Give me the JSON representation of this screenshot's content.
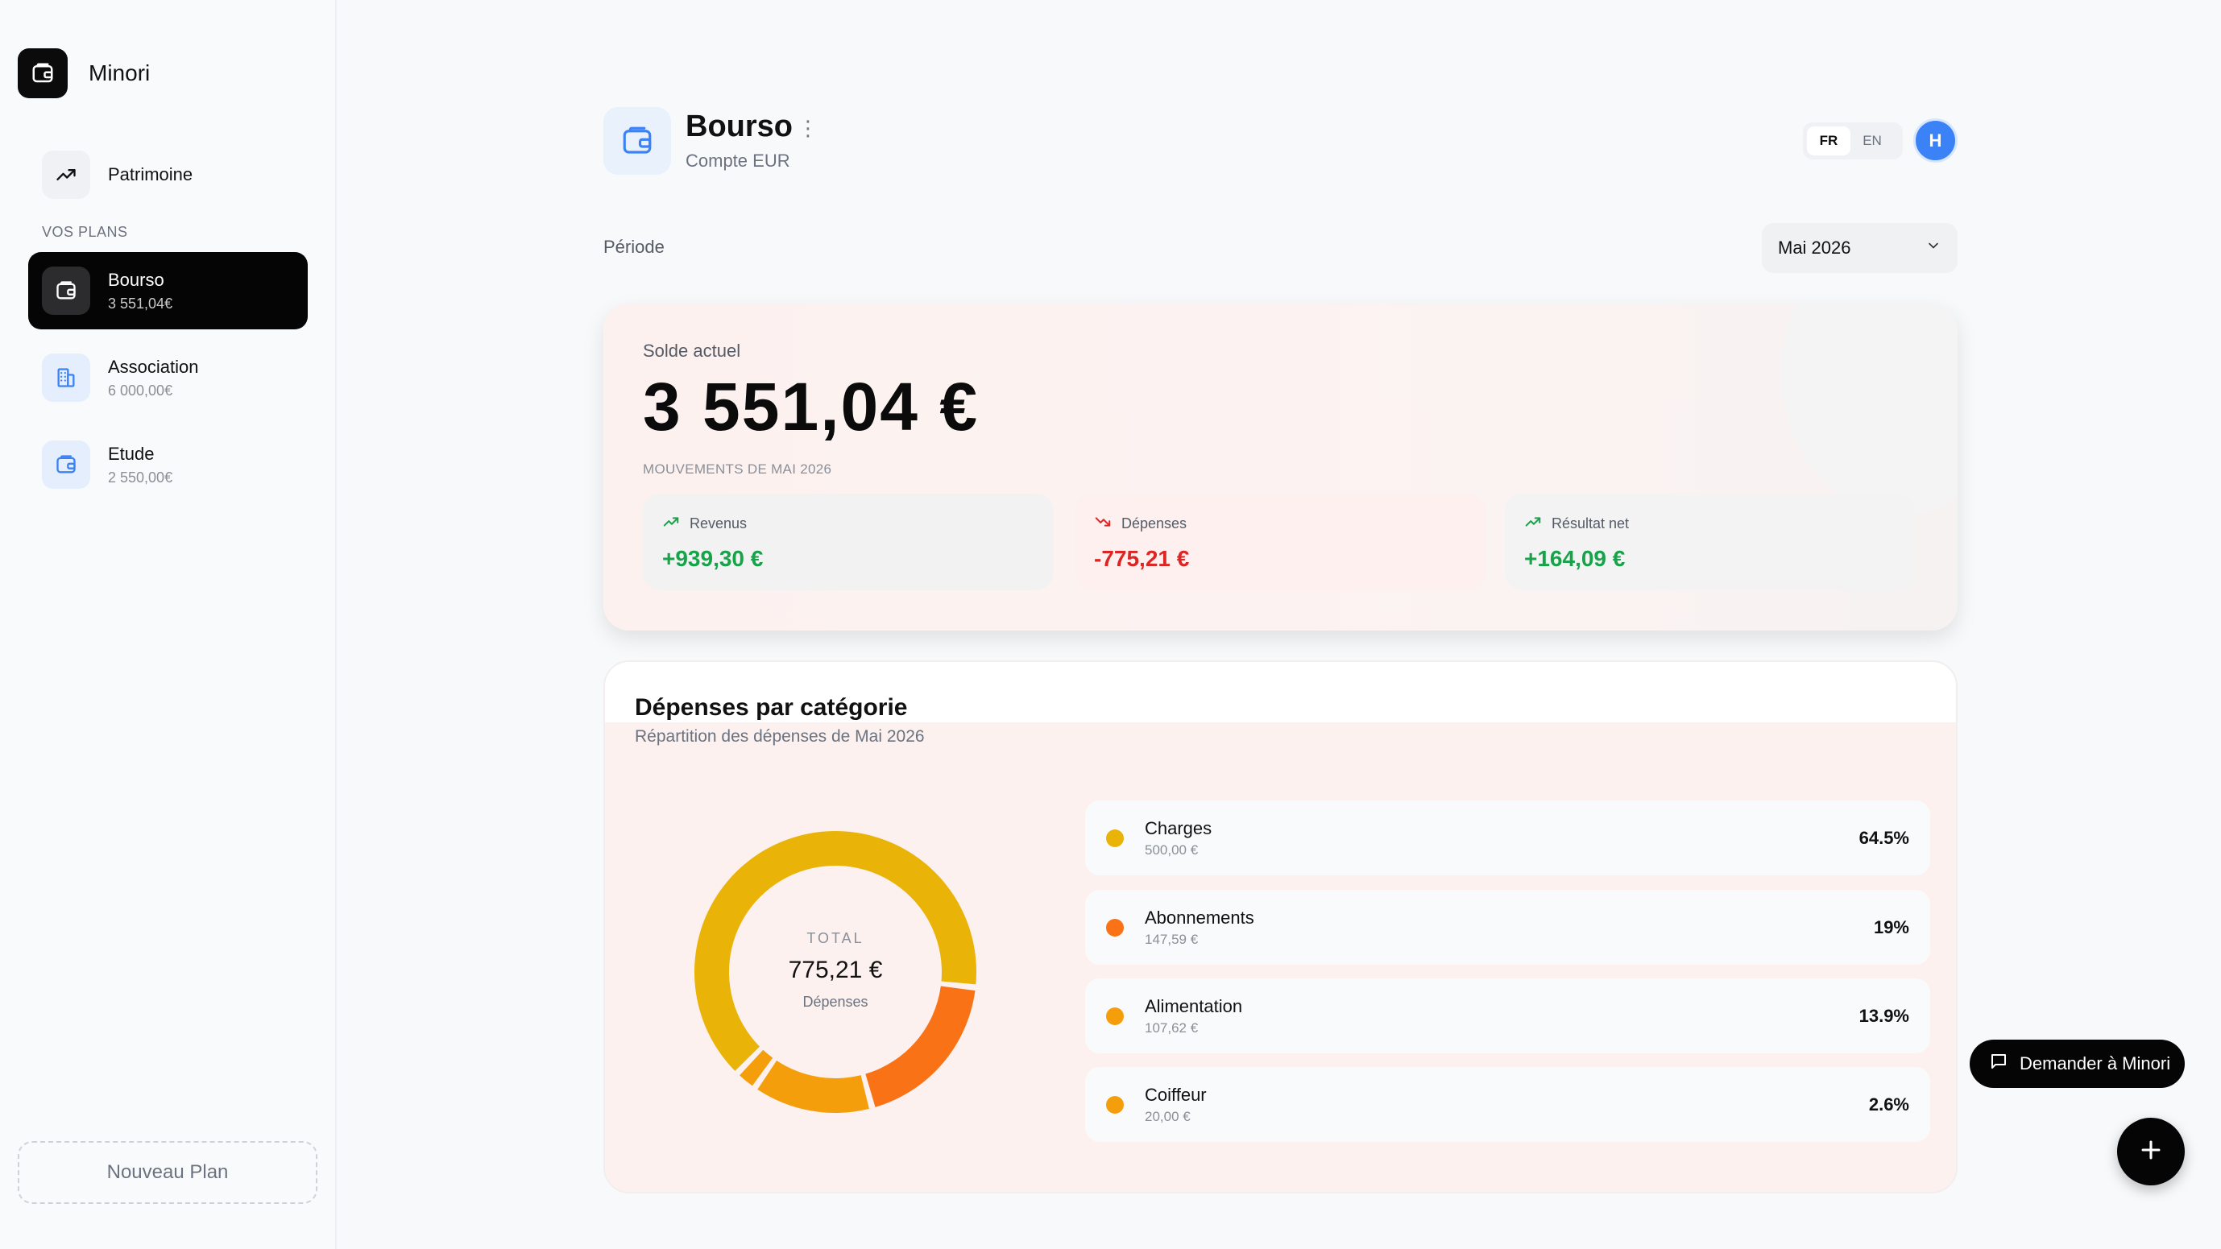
{
  "app": {
    "name": "Minori"
  },
  "sidebar": {
    "patrimoine_label": "Patrimoine",
    "section_title": "VOS PLANS",
    "plans": [
      {
        "name": "Bourso",
        "amount": "3 551,04€",
        "icon": "wallet-icon",
        "active": true
      },
      {
        "name": "Association",
        "amount": "6 000,00€",
        "icon": "building-icon",
        "active": false
      },
      {
        "name": "Etude",
        "amount": "2 550,00€",
        "icon": "wallet-icon",
        "active": false
      }
    ],
    "new_plan_label": "Nouveau Plan"
  },
  "header": {
    "title": "Bourso",
    "subtitle": "Compte EUR",
    "menu_icon": "⋮",
    "languages": [
      "FR",
      "EN"
    ],
    "active_language": "FR",
    "avatar_initial": "H"
  },
  "period": {
    "label": "Période",
    "selected": "Mai 2026"
  },
  "balance": {
    "label": "Solde actuel",
    "amount": "3 551,04 €",
    "movements_label": "MOUVEMENTS DE MAI 2026",
    "stats": {
      "revenus": {
        "label": "Revenus",
        "value": "+939,30 €"
      },
      "depenses": {
        "label": "Dépenses",
        "value": "-775,21 €"
      },
      "net": {
        "label": "Résultat net",
        "value": "+164,09 €"
      }
    }
  },
  "categories": {
    "title": "Dépenses par catégorie",
    "subtitle": "Répartition des dépenses de Mai 2026",
    "total_label": "TOTAL",
    "total_value": "775,21 €",
    "total_sub": "Dépenses",
    "items": [
      {
        "name": "Charges",
        "amount": "500,00 €",
        "pct": "64.5%",
        "color": "#eab308"
      },
      {
        "name": "Abonnements",
        "amount": "147,59 €",
        "pct": "19%",
        "color": "#f97316"
      },
      {
        "name": "Alimentation",
        "amount": "107,62 €",
        "pct": "13.9%",
        "color": "#f59e0b"
      },
      {
        "name": "Coiffeur",
        "amount": "20,00 €",
        "pct": "2.6%",
        "color": "#f59e0b"
      }
    ]
  },
  "chart_data": {
    "type": "pie",
    "categories": [
      "Charges",
      "Abonnements",
      "Alimentation",
      "Coiffeur"
    ],
    "values": [
      500.0,
      147.59,
      107.62,
      20.0
    ],
    "colors": [
      "#eab308",
      "#f97316",
      "#f59e0b",
      "#f59e0b"
    ]
  },
  "assistant": {
    "label": "Demander à Minori"
  },
  "colors": {
    "accent_blue": "#3b82f6",
    "positive": "#16a34a",
    "negative": "#dc2626"
  }
}
